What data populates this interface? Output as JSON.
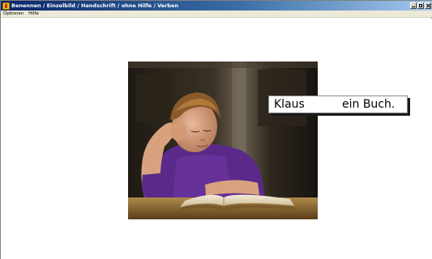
{
  "window": {
    "title": "Benennen / Einzelbild / Handschrift / ohne Hilfe / Verben"
  },
  "menu": {
    "items": [
      {
        "label": "Optionen"
      },
      {
        "label": "Hilfe"
      }
    ]
  },
  "exercise": {
    "subject": "Klaus",
    "object": "ein Buch."
  },
  "image": {
    "icon": "photo-boy-reading-book"
  },
  "colors": {
    "titlebar_start": "#0a246a",
    "titlebar_end": "#a6caf0",
    "shirt": "#5a2a8a"
  }
}
